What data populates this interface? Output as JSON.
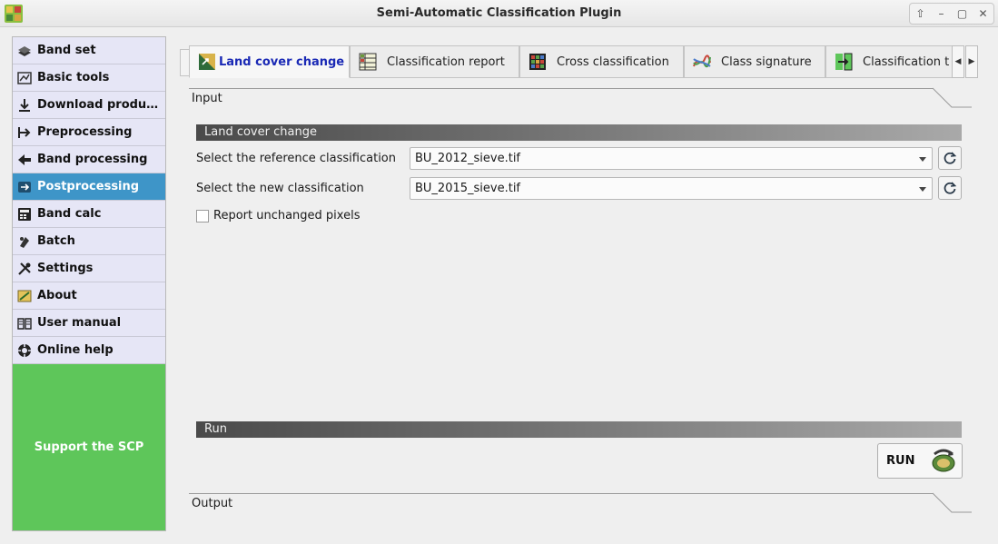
{
  "window": {
    "title": "Semi-Automatic Classification Plugin",
    "app_icon": "scp-logo-icon",
    "controls": [
      "up-arrow-icon",
      "minimize-icon",
      "maximize-icon",
      "close-icon"
    ]
  },
  "sidebar": {
    "items": [
      {
        "label": "Band set",
        "icon": "band-set-icon"
      },
      {
        "label": "Basic tools",
        "icon": "basic-tools-icon"
      },
      {
        "label": "Download produ…",
        "icon": "download-icon"
      },
      {
        "label": "Preprocessing",
        "icon": "preprocessing-icon"
      },
      {
        "label": "Band processing",
        "icon": "band-processing-icon"
      },
      {
        "label": "Postprocessing",
        "icon": "postprocessing-icon",
        "active": true
      },
      {
        "label": "Band calc",
        "icon": "band-calc-icon"
      },
      {
        "label": "Batch",
        "icon": "batch-icon"
      },
      {
        "label": "Settings",
        "icon": "settings-icon"
      },
      {
        "label": "About",
        "icon": "about-icon"
      },
      {
        "label": "User manual",
        "icon": "user-manual-icon"
      },
      {
        "label": "Online help",
        "icon": "online-help-icon"
      }
    ],
    "support_label": "Support the SCP",
    "active_color": "#3e95c8",
    "support_color": "#5ec65a"
  },
  "tabs": [
    {
      "label": "Land cover change",
      "icon": "land-cover-change-icon",
      "active": true
    },
    {
      "label": "Classification report",
      "icon": "classification-report-icon"
    },
    {
      "label": "Cross classification",
      "icon": "cross-classification-icon"
    },
    {
      "label": "Class signature",
      "icon": "class-signature-icon"
    },
    {
      "label": "Classification t",
      "icon": "classification-to-vector-icon"
    }
  ],
  "input_section": {
    "label": "Input"
  },
  "land_cover_change": {
    "header": "Land cover change",
    "reference_label": "Select the reference classification",
    "reference_value": "BU_2012_sieve.tif",
    "new_label": "Select the new classification",
    "new_value": "BU_2015_sieve.tif",
    "report_unchanged_label": "Report unchanged pixels",
    "report_unchanged_checked": false
  },
  "run_section": {
    "header": "Run",
    "run_label": "RUN"
  },
  "output_section": {
    "label": "Output"
  }
}
